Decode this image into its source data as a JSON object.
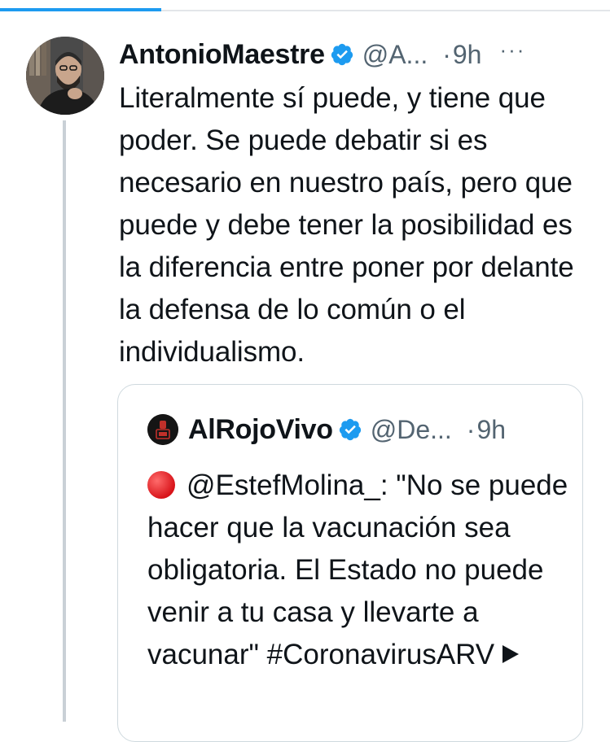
{
  "tweet": {
    "author_name": "AntonioMaestre",
    "handle": "@A...",
    "separator": "·",
    "time": "9h",
    "more": "···",
    "text": "Literalmente sí puede, y tiene que poder. Se puede debatir si es necesario en nuestro país, pero que puede y debe tener la posibilidad es la diferencia entre poner por delante la defensa de lo común o el individualismo."
  },
  "quoted": {
    "author_name": "AlRojoVivo",
    "handle": "@De...",
    "separator": "·",
    "time": "9h",
    "text": "@EstefMolina_: \"No se puede hacer que la vacunación sea obligatoria. El Estado no puede venir a tu casa y llevarte a vacunar\" #CoronavirusARV"
  },
  "colors": {
    "accent": "#1d9bf0",
    "verified": "#1d9bf0",
    "secondary_text": "#536471",
    "red_circle": "#d8141a"
  },
  "icons": [
    "verified-badge-icon",
    "more-icon",
    "red-circle-icon",
    "play-icon"
  ]
}
